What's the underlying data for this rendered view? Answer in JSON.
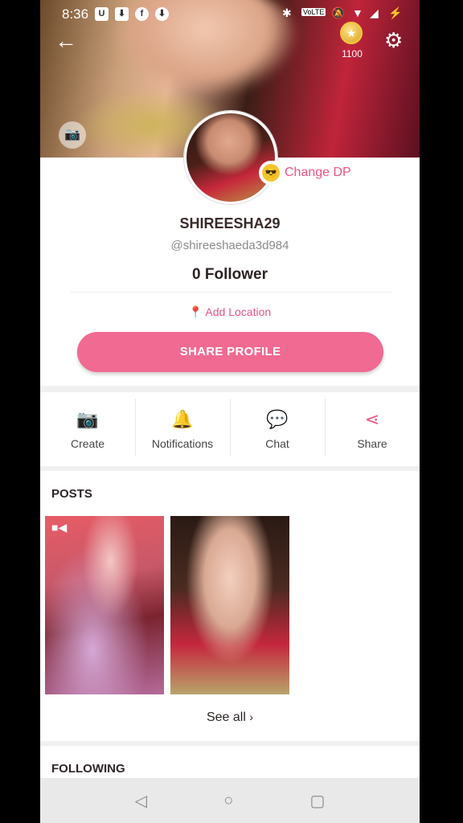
{
  "status_bar": {
    "time": "8:36",
    "left_icons": [
      "u-app-icon",
      "download-icon",
      "facebook-icon",
      "download-circle-icon"
    ],
    "right_icons": [
      "bluetooth-icon",
      "volte-icon",
      "mute-icon",
      "wifi-icon",
      "signal-icon",
      "battery-icon"
    ]
  },
  "header": {
    "back_icon": "back-arrow-icon",
    "coin_count": "1100",
    "settings_icon": "gear-icon"
  },
  "profile": {
    "change_dp_label": "Change DP",
    "username": "SHIREESHA29",
    "handle": "@shireeshaeda3d984",
    "followers": "0 Follower",
    "location_label": "Add Location",
    "share_button": "SHARE PROFILE"
  },
  "actions": [
    {
      "label": "Create",
      "icon": "camera-icon"
    },
    {
      "label": "Notifications",
      "icon": "bell-icon"
    },
    {
      "label": "Chat",
      "icon": "chat-icon"
    },
    {
      "label": "Share",
      "icon": "share-icon"
    }
  ],
  "posts": {
    "title": "POSTS",
    "see_all": "See all"
  },
  "following": {
    "title": "FOLLOWING"
  },
  "colors": {
    "accent": "#ee5483",
    "button": "#f06a92"
  }
}
